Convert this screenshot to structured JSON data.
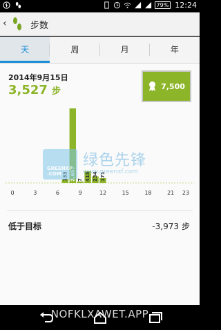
{
  "status_bar": {
    "battery": "79%",
    "time": "12:24"
  },
  "app_bar": {
    "back_icon": "chevron-left-icon",
    "logo_icon": "footprints-icon",
    "title": "步数"
  },
  "tabs": [
    {
      "label": "天",
      "active": true
    },
    {
      "label": "周",
      "active": false
    },
    {
      "label": "月",
      "active": false
    },
    {
      "label": "年",
      "active": false
    }
  ],
  "summary": {
    "date": "2014年9月15日",
    "steps": "3,527",
    "steps_unit": "步",
    "goal_icon": "award-ribbon-icon",
    "goal": "7,500"
  },
  "chart_data": {
    "type": "bar",
    "x_ticks": [
      "0",
      "3",
      "6",
      "9",
      "12",
      "15",
      "18",
      "21",
      "23"
    ],
    "x": [
      7,
      8,
      9,
      10,
      11,
      12
    ],
    "values": [
      133,
      2657,
      7,
      415,
      234,
      171
    ],
    "value_labels": [
      "133",
      "2,657",
      "7",
      "415",
      "234",
      "171"
    ],
    "bar_color": "#8db52a",
    "goal_line_color": "#c7d88a"
  },
  "watermark": {
    "box_text": "GREENXF .COM",
    "cn": "绿色先锋",
    "url": "www.greenxf.com"
  },
  "below_goal": {
    "label": "低于目标",
    "value": "-3,973",
    "unit": "步"
  },
  "nav_bar": {
    "back_icon": "back-icon",
    "home_icon": "home-icon",
    "recent_icon": "recent-apps-icon"
  },
  "overlay": "NOFKLXAWET.APP"
}
